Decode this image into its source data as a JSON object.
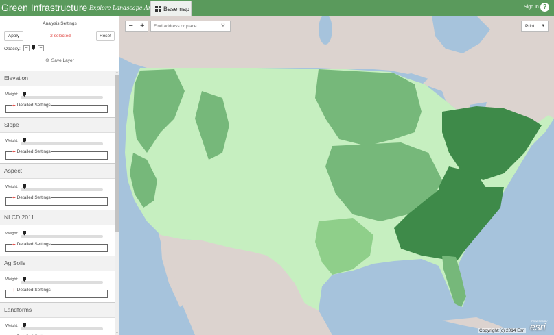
{
  "header": {
    "title": "Green Infrastructure",
    "subtitle": "Explore Landscape Analysis",
    "basemap_label": "Basemap",
    "signin_label": "Sign In",
    "help_label": "?"
  },
  "sidebar": {
    "settings_title": "Analysis Settings",
    "apply_label": "Apply",
    "selected_text": "2 selected",
    "reset_label": "Reset",
    "opacity_label": "Opacity:",
    "opacity_minus": "−",
    "opacity_plus": "+",
    "save_layer_label": "Save Layer",
    "weight_label": "Weight:",
    "details_label": "Detailed Settings",
    "layers": [
      {
        "name": "Elevation"
      },
      {
        "name": "Slope"
      },
      {
        "name": "Aspect"
      },
      {
        "name": "NLCD 2011"
      },
      {
        "name": "Ag Soils"
      },
      {
        "name": "Landforms"
      }
    ]
  },
  "map": {
    "zoom_out": "−",
    "zoom_in": "+",
    "search_placeholder": "Find address or place",
    "print_label": "Print",
    "esri_powered": "POWERED BY",
    "esri_logo": "esri",
    "copyright": "Copyright:(c) 2014 Esri"
  },
  "colors": {
    "header": "#5a9a5c",
    "water": "#a6c3dc",
    "land": "#dcd3cf",
    "green_light": "#c6efc0",
    "green_mid": "#76b87a",
    "green_dark": "#3e8a49",
    "accent_red": "#e0413c"
  }
}
